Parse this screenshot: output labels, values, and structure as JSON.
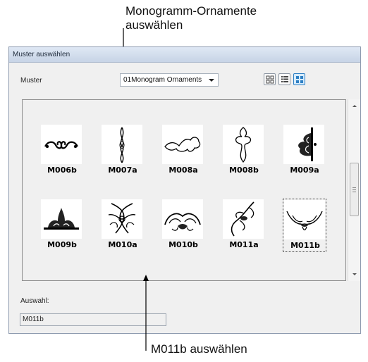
{
  "annotations": {
    "top_line1": "Monogramm-Ornamente",
    "top_line2": "auswählen",
    "bottom": "M011b auswählen"
  },
  "dialog": {
    "title": "Muster auswählen",
    "pattern_label": "Muster",
    "pattern_value": "01Monogram Ornaments",
    "view_buttons": [
      "large-icons-view",
      "list-view",
      "thumbnail-view"
    ],
    "active_view": "thumbnail-view",
    "selection_label": "Auswahl:",
    "selection_value": "M011b"
  },
  "patterns": [
    {
      "name": "M006b"
    },
    {
      "name": "M007a"
    },
    {
      "name": "M008a"
    },
    {
      "name": "M008b"
    },
    {
      "name": "M009a"
    },
    {
      "name": "M009b"
    },
    {
      "name": "M010a"
    },
    {
      "name": "M010b"
    },
    {
      "name": "M011a"
    },
    {
      "name": "M011b",
      "selected": true
    }
  ],
  "scrollbar": {
    "position": 0.45
  }
}
